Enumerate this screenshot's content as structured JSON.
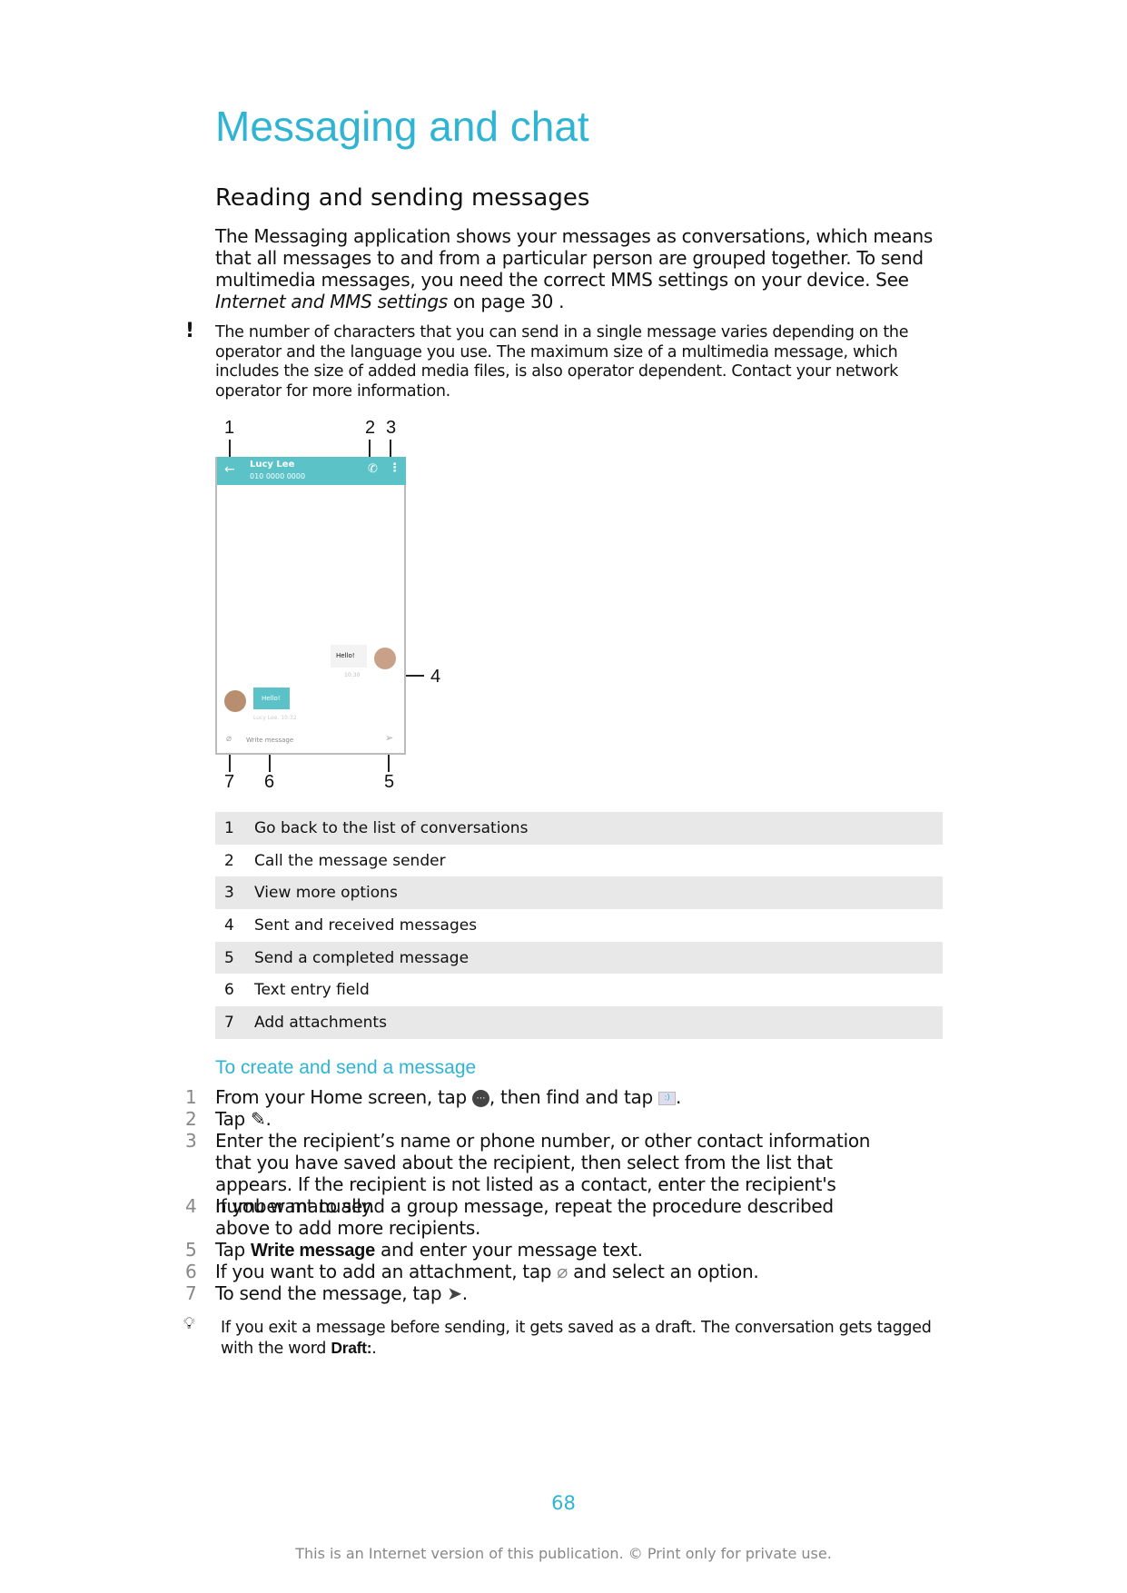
{
  "title": "Messaging and chat",
  "section": {
    "heading": "Reading and sending messages",
    "intro": "The Messaging application shows your messages as conversations, which means that all messages to and from a particular person are grouped together. To send multimedia messages, you need the correct MMS settings on your device. See",
    "intro_link": "Internet and MMS settings",
    "intro_tail": " on page 30 .",
    "note": "The number of characters that you can send in a single message varies depending on the operator and the language you use. The maximum size of a multimedia message, which includes the size of added media files, is also operator dependent. Contact your network operator for more information."
  },
  "phone": {
    "contact_name": "Lucy Lee",
    "contact_number": "010 0000 0000",
    "sent_text": "Hello!",
    "received_text": "Hello!",
    "received_meta": "Lucy Lee, 10:32",
    "sent_meta": "10:30",
    "input_placeholder": "Write message",
    "accent": "#5bc3c8"
  },
  "callouts": [
    "1",
    "2",
    "3",
    "4",
    "5",
    "6",
    "7"
  ],
  "legend": [
    {
      "num": "1",
      "text": "Go back to the list of conversations"
    },
    {
      "num": "2",
      "text": "Call the message sender"
    },
    {
      "num": "3",
      "text": "View more options"
    },
    {
      "num": "4",
      "text": "Sent and received messages"
    },
    {
      "num": "5",
      "text": "Send a completed message"
    },
    {
      "num": "6",
      "text": "Text entry field"
    },
    {
      "num": "7",
      "text": "Add attachments"
    }
  ],
  "procedure": {
    "heading": "To create and send a message",
    "steps": [
      {
        "num": "1",
        "a": "From your Home screen, tap ",
        "b": ", then find and tap ",
        "c": "."
      },
      {
        "num": "2",
        "a": "Tap ",
        "c": "."
      },
      {
        "num": "3",
        "a": "Enter the recipient’s name or phone number, or other contact information that you have saved about the recipient, then select from the list that appears. If the recipient is not listed as a contact, enter the recipient's number manually."
      },
      {
        "num": "4",
        "a": "If you want to send a group message, repeat the procedure described above to add more recipients."
      },
      {
        "num": "5",
        "a": "Tap ",
        "bold": "Write message",
        "c": " and enter your message text."
      },
      {
        "num": "6",
        "a": "If you want to add an attachment, tap ",
        "c": " and select an option."
      },
      {
        "num": "7",
        "a": "To send the message, tap ",
        "c": "."
      }
    ],
    "tip": "If you exit a message before sending, it gets saved as a draft. The conversation gets tagged with the word ",
    "tip_bold": "Draft:",
    "tip_end": "."
  },
  "page_number": "68",
  "footer": "This is an Internet version of this publication. © Print only for private use."
}
